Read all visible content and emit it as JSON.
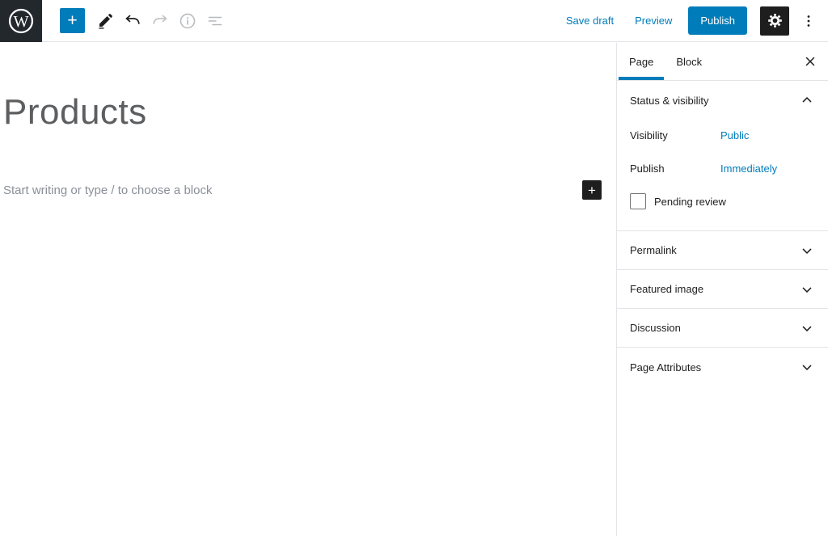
{
  "colors": {
    "accent_blue": "#007cba",
    "dark": "#1e1e1e",
    "logo_background": "#23282d",
    "muted_text": "#8a8f98",
    "border": "#e2e4e7"
  },
  "header": {
    "inserter_label": "+",
    "save_draft_label": "Save draft",
    "preview_label": "Preview",
    "publish_label": "Publish",
    "icons": {
      "logo": "wordpress-logo",
      "tools": "pencil-icon",
      "undo": "undo-arrow-icon",
      "redo": "redo-arrow-icon",
      "info": "info-circle-icon",
      "list_view": "list-view-icon",
      "settings": "gear-icon",
      "options": "ellipsis-icon"
    }
  },
  "editor": {
    "title": "Products",
    "body_placeholder": "Start writing or type / to choose a block",
    "inserter_label": "+"
  },
  "sidebar": {
    "tabs": [
      {
        "label": "Page",
        "active": true
      },
      {
        "label": "Block",
        "active": false
      }
    ],
    "status_panel": {
      "title": "Status & visibility",
      "rows": [
        {
          "label": "Visibility",
          "value": "Public"
        },
        {
          "label": "Publish",
          "value": "Immediately"
        }
      ],
      "pending_review_label": "Pending review"
    },
    "collapsed_panels": [
      {
        "label": "Permalink"
      },
      {
        "label": "Featured image"
      },
      {
        "label": "Discussion"
      },
      {
        "label": "Page Attributes"
      }
    ]
  }
}
